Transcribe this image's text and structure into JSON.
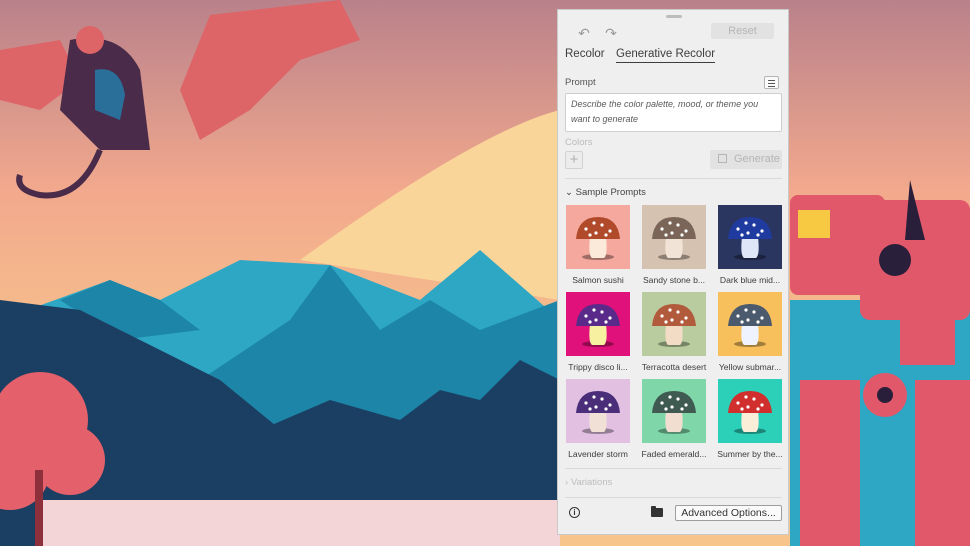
{
  "colors": {
    "sky_top": "#b9818b",
    "sky_mid": "#f2a98d",
    "sky_low": "#f7c48c",
    "glow": "#fad59a",
    "mountain_far": "#2ea7c4",
    "mountain_mid": "#1d86a8",
    "mountain_dark": "#1b3f62",
    "ground": "#f3d5d7",
    "dragon": "#dd6467",
    "robot": "#e0586a"
  },
  "panel": {
    "undo_icon": "undo-icon",
    "redo_icon": "redo-icon",
    "reset_label": "Reset",
    "tabs": [
      "Recolor",
      "Generative Recolor"
    ],
    "prompt_label": "Prompt",
    "prompt_placeholder": "Describe the color palette, mood, or theme you want to generate",
    "colors_label": "Colors",
    "add_color": "+",
    "generate_label": "Generate",
    "sample_header": "Sample Prompts",
    "samples": [
      {
        "label": "Salmon sushi",
        "bg": "#f5a89d",
        "cap": "#b14a2a",
        "stem": "#fbe9da"
      },
      {
        "label": "Sandy stone b...",
        "bg": "#d6c2b0",
        "cap": "#7a6558",
        "stem": "#f1e4d6"
      },
      {
        "label": "Dark blue mid...",
        "bg": "#2a3560",
        "cap": "#1f3ba0",
        "stem": "#dfe6f7"
      },
      {
        "label": "Trippy disco li...",
        "bg": "#e0117a",
        "cap": "#5a2a8a",
        "stem": "#f6f0a0"
      },
      {
        "label": "Terracotta desert",
        "bg": "#b8cc9f",
        "cap": "#b25a3c",
        "stem": "#f3dcc6"
      },
      {
        "label": "Yellow submar...",
        "bg": "#f7c05c",
        "cap": "#4b5a6d",
        "stem": "#eef3ff"
      },
      {
        "label": "Lavender storm",
        "bg": "#e2c0e2",
        "cap": "#4a2e7a",
        "stem": "#f1e0d6"
      },
      {
        "label": "Faded emerald...",
        "bg": "#7fd6a8",
        "cap": "#3f5a50",
        "stem": "#f1ded0"
      },
      {
        "label": "Summer by the...",
        "bg": "#2ccfb8",
        "cap": "#d12e2e",
        "stem": "#fbeed8"
      }
    ],
    "variations_label": "Variations",
    "advanced_label": "Advanced Options..."
  }
}
